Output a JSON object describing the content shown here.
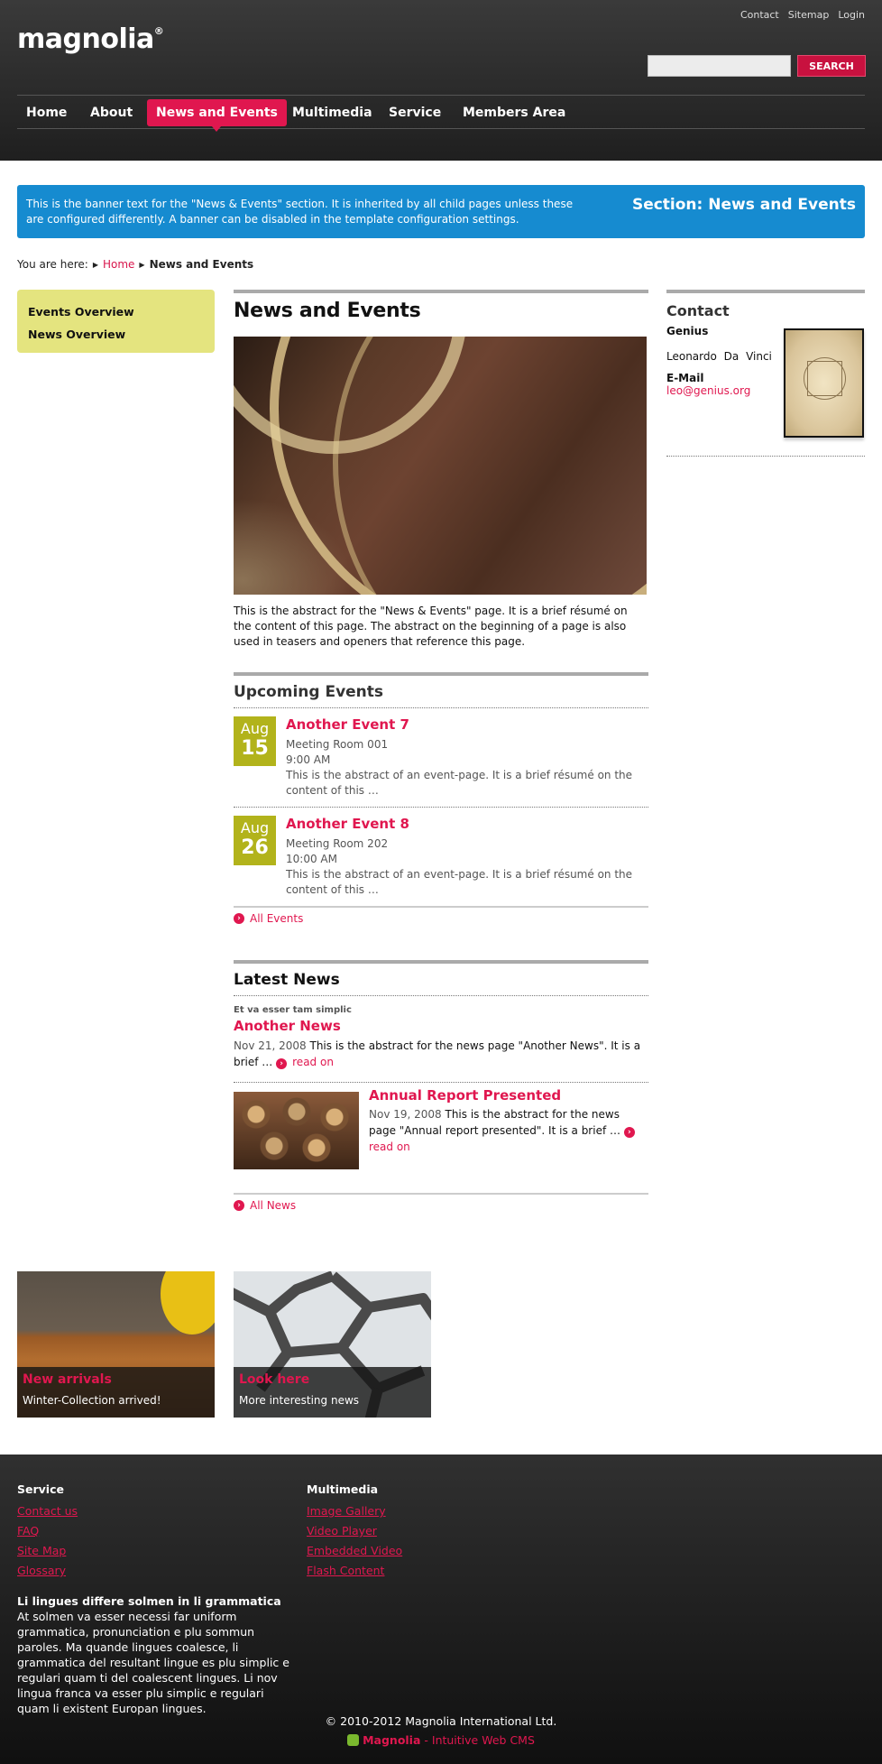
{
  "header": {
    "logo": "magnolia",
    "meta_nav": [
      "Contact",
      "Sitemap",
      "Login"
    ],
    "search": {
      "placeholder": "",
      "button": "SEARCH"
    },
    "nav": [
      "Home",
      "About",
      "News and Events",
      "Multimedia",
      "Service",
      "Members Area"
    ],
    "active_nav": "News and Events"
  },
  "banner": {
    "text": "This is the banner text for the \"News & Events\" section. It is inherited by all child pages unless these are configured differently. A banner can be disabled in the template configuration settings.",
    "title": "Section: News and Events"
  },
  "breadcrumb": {
    "prefix": "You are here:",
    "home": "Home",
    "current": "News and Events"
  },
  "subnav": [
    "Events Overview",
    "News Overview"
  ],
  "main": {
    "title": "News and Events",
    "abstract": "This is the abstract for the \"News & Events\" page. It is a brief résumé on the content of this page. The abstract on the beginning of a page is also used in teasers and openers that reference this page."
  },
  "events": {
    "heading": "Upcoming Events",
    "items": [
      {
        "month": "Aug",
        "day": "15",
        "title": "Another Event 7",
        "location": "Meeting Room 001",
        "time": "9:00 AM",
        "abstract": "This is the abstract of an event-page. It is a brief résumé on the content of this …"
      },
      {
        "month": "Aug",
        "day": "26",
        "title": "Another Event 8",
        "location": "Meeting Room 202",
        "time": "10:00 AM",
        "abstract": "This is the abstract of an event-page. It is a brief résumé on the content of this …"
      }
    ],
    "all_link": "All Events"
  },
  "news": {
    "heading": "Latest News",
    "items": [
      {
        "kicker": "Et va esser tam simplic",
        "title": "Another News",
        "date": "Nov 21, 2008",
        "text": "This is the abstract for the news page \"Another News\". It is a brief …",
        "read_on": "read on"
      },
      {
        "title": "Annual Report Presented",
        "date": "Nov 19, 2008",
        "text": "This is the abstract for the news page \"Annual report presented\". It is a brief …",
        "read_on": "read on"
      }
    ],
    "all_link": "All News"
  },
  "contact": {
    "heading": "Contact",
    "org": "Genius",
    "name": "Leonardo Da Vinci",
    "email_label": "E-Mail",
    "email": "leo@genius.org"
  },
  "teasers": [
    {
      "title": "New arrivals",
      "text": "Winter-Collection arrived!"
    },
    {
      "title": "Look here",
      "text": "More interesting news"
    }
  ],
  "footer": {
    "columns": [
      {
        "heading": "Service",
        "links": [
          "Contact us",
          "FAQ",
          "Site Map",
          "Glossary"
        ]
      },
      {
        "heading": "Multimedia",
        "links": [
          "Image Gallery",
          "Video Player",
          "Embedded Video",
          "Flash Content"
        ]
      }
    ],
    "blurb_title": "Li lingues differe solmen in li grammatica",
    "blurb_text": "At solmen va esser necessi far uniform grammatica, pronunciation e plu sommun paroles. Ma quande lingues coalesce, li grammatica del resultant lingue es plu simplic e regulari quam ti del coalescent lingues. Li nov lingua franca va esser plu simplic e regulari quam li existent Europan lingues.",
    "copyright": "© 2010-2012 Magnolia International Ltd.",
    "powered_brand": "Magnolia",
    "powered_text": " - Intuitive Web CMS"
  },
  "colors": {
    "accent": "#e0174f",
    "banner": "#168bd0",
    "date_badge": "#b2b31b",
    "subnav": "#e4e47f"
  }
}
